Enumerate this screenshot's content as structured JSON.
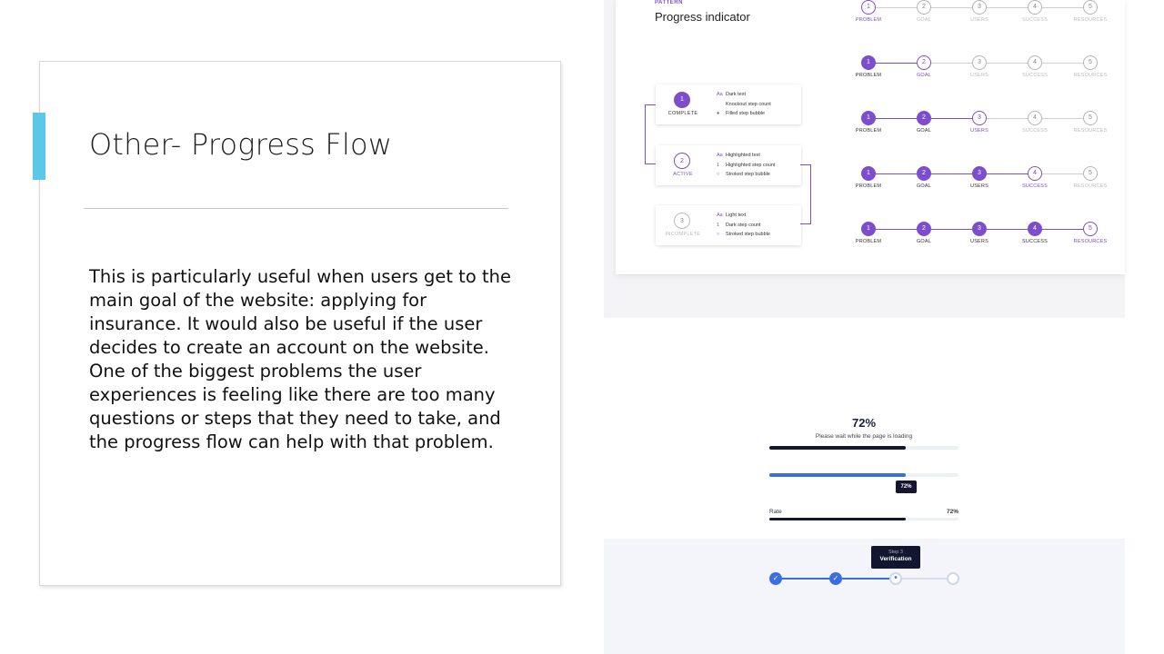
{
  "slide": {
    "title": "Other- Progress Flow",
    "body": "This is particularly useful when users get to the main goal of the website: applying for insurance. It would also be useful if the user decides to create an account on the website. One of the biggest problems the user experiences is feeling like there are too many questions or steps that they need to take, and the progress flow can help with that problem.",
    "accent_color": "#5bc8ea"
  },
  "pattern_image": {
    "eyebrow": "PATTERN",
    "title": "Progress indicator",
    "accent_color": "#7c4dcc",
    "legend": [
      {
        "number": "1",
        "state": "COMPLETE",
        "lines": [
          {
            "marker": "Aa",
            "text": "Dark text"
          },
          {
            "marker": "",
            "text": "Knockout step count"
          },
          {
            "marker": "●",
            "text": "Filled step bubble"
          }
        ]
      },
      {
        "number": "2",
        "state": "ACTIVE",
        "lines": [
          {
            "marker": "Aa",
            "text": "Highlighted text"
          },
          {
            "marker": "1",
            "text": "Highlighted step count"
          },
          {
            "marker": "○",
            "text": "Stroked step bubble"
          }
        ]
      },
      {
        "number": "3",
        "state": "INCOMPLETE",
        "lines": [
          {
            "marker": "Aa",
            "text": "Light text"
          },
          {
            "marker": "1",
            "text": "Dark step count"
          },
          {
            "marker": "○",
            "text": "Stroked step bubble"
          }
        ]
      }
    ],
    "steps": [
      "PROBLEM",
      "GOAL",
      "USERS",
      "SUCCESS",
      "RESOURCES"
    ],
    "rows_active_index": [
      0,
      1,
      2,
      3,
      4
    ]
  },
  "loading_image": {
    "percent_text": "72%",
    "subtitle": "Please wait while the page is loading",
    "progress": 0.72,
    "tooltip": "72%",
    "rate_label": "Rate",
    "rate_value": "72%",
    "colors": {
      "dark": "#12162e",
      "blue": "#3b6fe0",
      "track": "#edf0f7"
    },
    "stepper": {
      "tooltip_step": "Step 3",
      "tooltip_title": "Verification",
      "completed": 2,
      "current": 3,
      "total": 4
    }
  }
}
